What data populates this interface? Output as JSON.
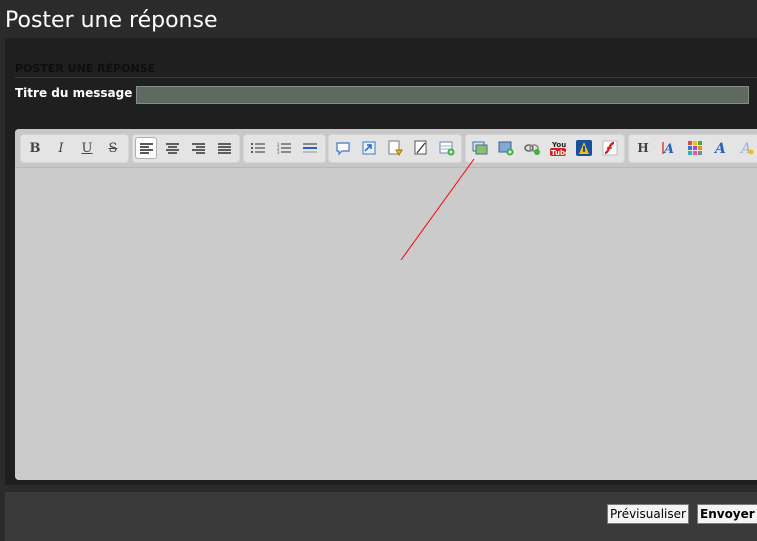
{
  "page": {
    "title": "Poster une réponse"
  },
  "form": {
    "section_title": "POSTER UNE RÉPONSE",
    "subject_label": "Titre du message",
    "subject_value": ""
  },
  "toolbar": {
    "groups": [
      [
        "bold-icon",
        "italic-icon",
        "underline-icon",
        "strikethrough-icon"
      ],
      [
        "align-left-icon",
        "align-center-icon",
        "align-right-icon",
        "justify-icon"
      ],
      [
        "bulleted-list-icon",
        "numbered-list-icon",
        "horizontal-rule-icon"
      ],
      [
        "quote-icon",
        "code-icon",
        "spoiler-icon",
        "hide-icon",
        "table-icon"
      ],
      [
        "image-icon",
        "upload-image-icon",
        "link-icon",
        "youtube-icon",
        "dailymotion-icon",
        "flash-icon"
      ],
      [
        "heading-icon",
        "font-size-icon",
        "color-icon",
        "font-icon",
        "fancy-text-icon"
      ]
    ],
    "text_glyphs": {
      "bold": "B",
      "italic": "I",
      "underline": "U",
      "strike": "S",
      "heading": "H"
    },
    "youtube_label_top": "You",
    "youtube_label_bottom": "Tube",
    "active": "align-left-icon"
  },
  "buttons": {
    "preview": "Prévisualiser",
    "send": "Envoyer"
  },
  "colors": {
    "background": "#2b2b2b",
    "panel": "#1f1f1f",
    "input_bg": "#5e6a5f",
    "editor_bg": "#cbcbcb",
    "annotation": "#ff0000"
  }
}
